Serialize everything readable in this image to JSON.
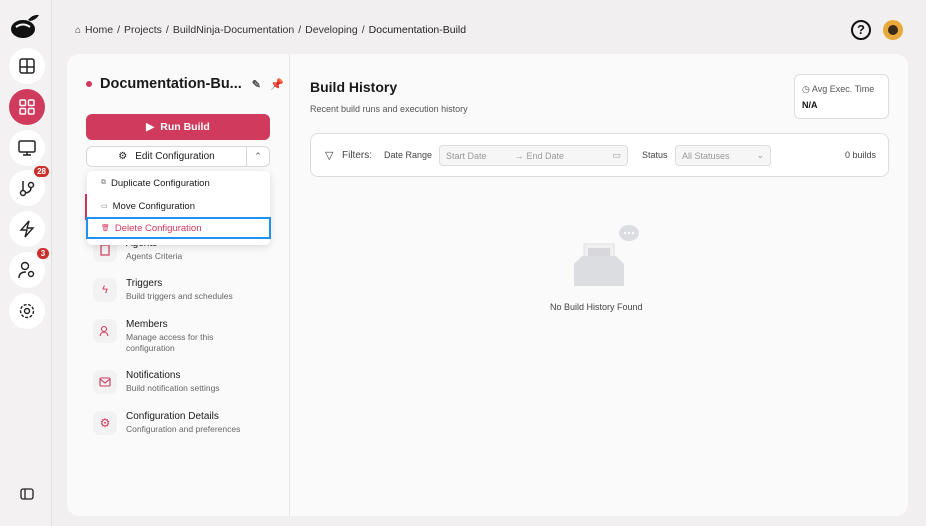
{
  "breadcrumb": {
    "items": [
      "Home",
      "Projects",
      "BuildNinja-Documentation",
      "Developing"
    ],
    "current": "Documentation-Build"
  },
  "rail": {
    "badges": {
      "branches": "28",
      "users": "3"
    },
    "accent": "#d03a5d"
  },
  "config": {
    "title": "Documentation-Bu...",
    "run_label": "Run Build",
    "edit_label": "Edit Configuration"
  },
  "menu": {
    "items": [
      "Duplicate Configuration",
      "Move Configuration",
      "Delete Configuration"
    ]
  },
  "nav": [
    {
      "title": "Agents",
      "sub": "Agents Criteria"
    },
    {
      "title": "Triggers",
      "sub": "Build triggers and schedules"
    },
    {
      "title": "Members",
      "sub": "Manage access for this configuration"
    },
    {
      "title": "Notifications",
      "sub": "Build notification settings"
    },
    {
      "title": "Configuration Details",
      "sub": "Configuration and preferences"
    }
  ],
  "history": {
    "title": "Build History",
    "subtitle": "Recent build runs and execution history",
    "avg_label": "Avg Exec. Time",
    "avg_value": "N/A",
    "filters_label": "Filters:",
    "date_range_label": "Date Range",
    "start_placeholder": "Start Date",
    "end_placeholder": "End Date",
    "status_label": "Status",
    "status_value": "All Statuses",
    "count": "0 builds",
    "empty": "No Build History Found"
  }
}
